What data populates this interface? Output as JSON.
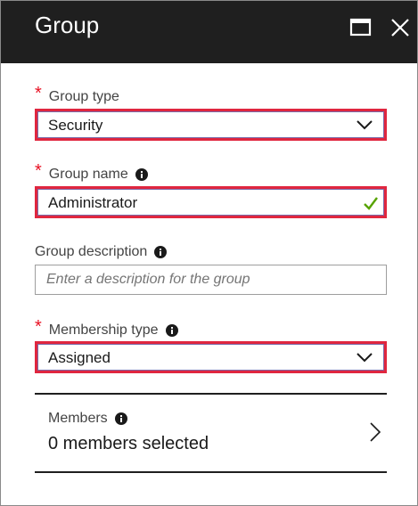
{
  "window": {
    "title": "Group",
    "maximize_icon": "maximize-icon",
    "close_icon": "close-icon"
  },
  "form": {
    "group_type": {
      "label": "Group type",
      "required_marker": "*",
      "value": "Security"
    },
    "group_name": {
      "label": "Group name",
      "required_marker": "*",
      "value": "Administrator",
      "valid": true
    },
    "group_description": {
      "label": "Group description",
      "placeholder": "Enter a description for the group",
      "value": ""
    },
    "membership_type": {
      "label": "Membership type",
      "required_marker": "*",
      "value": "Assigned"
    },
    "members": {
      "label": "Members",
      "count_text": "0 members selected"
    }
  },
  "colors": {
    "titlebar": "#1f1f1f",
    "required": "#e81123",
    "highlight_border": "#e0263f",
    "valid_check": "#57a300"
  }
}
